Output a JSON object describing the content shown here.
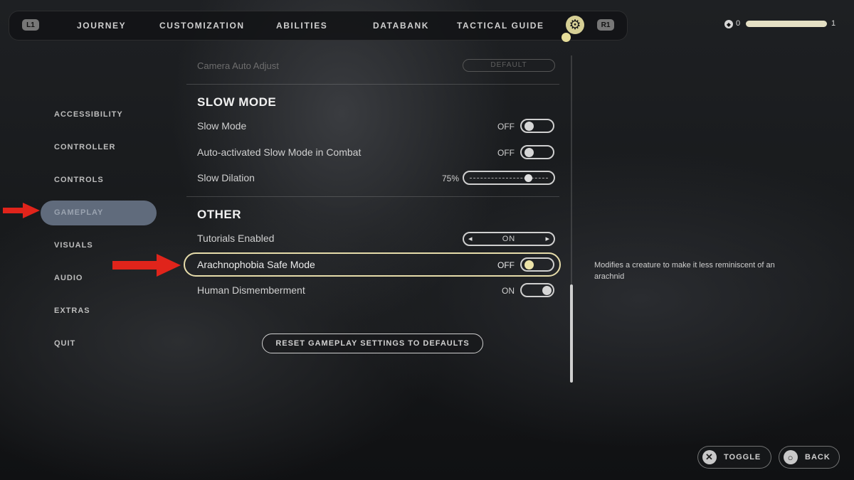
{
  "top_nav": {
    "left_button": "L1",
    "right_button": "R1",
    "tabs": [
      "JOURNEY",
      "CUSTOMIZATION",
      "ABILITIES",
      "DATABANK",
      "TACTICAL GUIDE"
    ],
    "settings_icon": "gear-icon"
  },
  "xp": {
    "left_value": "0",
    "right_value": "1",
    "progress": 0.97
  },
  "sidebar": {
    "items": [
      "ACCESSIBILITY",
      "CONTROLLER",
      "CONTROLS",
      "GAMEPLAY",
      "VISUALS",
      "AUDIO",
      "EXTRAS",
      "QUIT"
    ],
    "active": "GAMEPLAY"
  },
  "content": {
    "faded_row": {
      "label": "Camera Auto Adjust",
      "value": "DEFAULT"
    },
    "slow_mode": {
      "title": "SLOW MODE",
      "rows": [
        {
          "label": "Slow Mode",
          "value": "OFF"
        },
        {
          "label": "Auto-activated Slow Mode in Combat",
          "value": "OFF"
        },
        {
          "label": "Slow Dilation",
          "value": "75%"
        }
      ]
    },
    "other": {
      "title": "OTHER",
      "rows": [
        {
          "label": "Tutorials Enabled",
          "value": "ON"
        },
        {
          "label": "Arachnophobia Safe Mode",
          "value": "OFF"
        },
        {
          "label": "Human Dismemberment",
          "value": "ON"
        }
      ]
    },
    "reset_button": "RESET GAMEPLAY SETTINGS TO DEFAULTS"
  },
  "description": "Modifies a creature to make it less reminiscent of an arachnid",
  "footer": {
    "toggle_label": "TOGGLE",
    "back_label": "BACK"
  },
  "colors": {
    "highlight": "#e6dcaa",
    "active_nav": "#606b7c",
    "arrow": "#e0241b"
  }
}
